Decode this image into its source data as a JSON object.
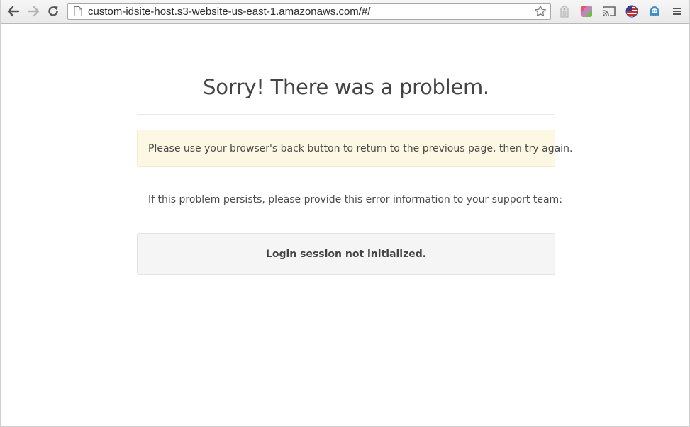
{
  "browser": {
    "url": "custom-idsite-host.s3-website-us-east-1.amazonaws.com/#/",
    "icons": {
      "back": "back-arrow-icon",
      "forward": "forward-arrow-icon",
      "reload": "reload-icon",
      "page": "page-icon",
      "bookmark": "star-icon",
      "extensions": [
        "extension-tag-icon",
        "colorful-square-icon",
        "cast-icon",
        "flag-globe-icon",
        "ghostery-icon"
      ],
      "menu": "hamburger-menu-icon"
    }
  },
  "page": {
    "title": "Sorry! There was a problem.",
    "warning": "Please use your browser's back button to return to the previous page, then try again.",
    "persist_message": "If this problem persists, please provide this error information to your support team:",
    "error_message": "Login session not initialized."
  },
  "colors": {
    "warning_bg": "#fcf8e3",
    "error_bg": "#f5f5f5",
    "text": "#444444"
  }
}
